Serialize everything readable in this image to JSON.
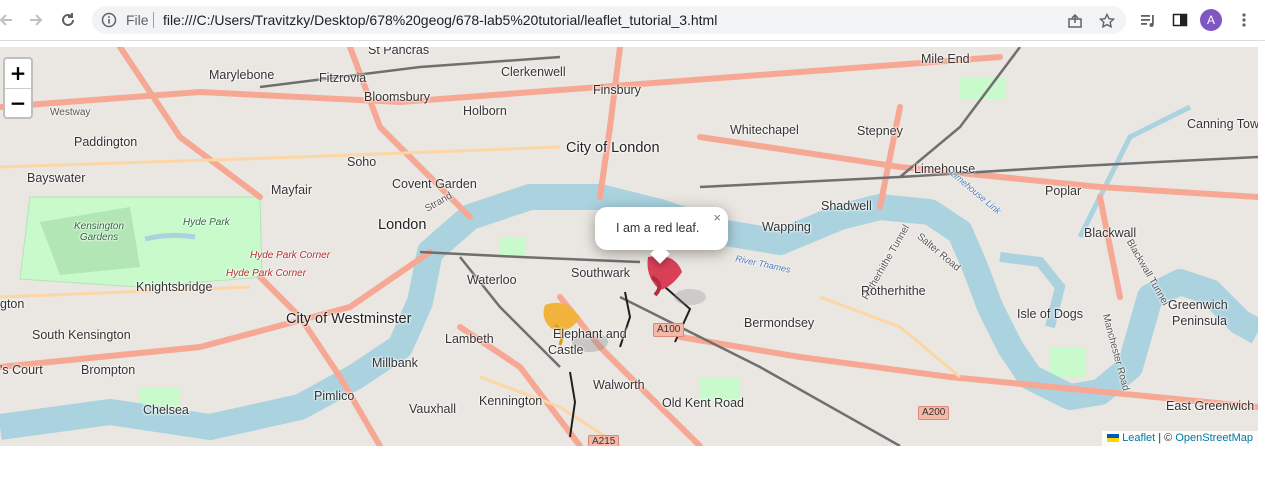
{
  "browser": {
    "scheme_label": "File",
    "url": "file:///C:/Users/Travitzky/Desktop/678%20geog/678-lab5%20tutorial/leaflet_tutorial_3.html",
    "avatar_initial": "A",
    "icons": [
      "back-arrow-icon",
      "forward-arrow-icon",
      "reload-icon",
      "info-icon",
      "share-icon",
      "star-icon",
      "media-icon",
      "side-panel-icon",
      "kebab-menu-icon"
    ],
    "avatar_color": "#7e57c2"
  },
  "map": {
    "zoom_in": "+",
    "zoom_out": "−",
    "popup": {
      "text": "I am a red leaf.",
      "close": "×"
    },
    "attribution": {
      "leaflet": "Leaflet",
      "sep": " | © ",
      "osm": "OpenStreetMap"
    },
    "labels": {
      "st_pancras": "St Pancras",
      "marylebone": "Marylebone",
      "fitzrovia": "Fitzrovia",
      "clerkenwell": "Clerkenwell",
      "mile_end": "Mile End",
      "westway": "Westway",
      "bloomsbury": "Bloomsbury",
      "finsbury": "Finsbury",
      "paddington": "Paddington",
      "holborn": "Holborn",
      "whitechapel": "Whitechapel",
      "stepney": "Stepney",
      "canning_town": "Canning Tow",
      "city_of_london": "City of London",
      "soho": "Soho",
      "bayswater": "Bayswater",
      "covent_garden": "Covent Garden",
      "limehouse": "Limehouse",
      "mayfair": "Mayfair",
      "poplar": "Poplar",
      "strand": "Strand",
      "hyde_park": "Hyde Park",
      "kensington_gardens": "Kensington Gardens",
      "shadwell": "Shadwell",
      "london": "London",
      "wapping": "Wapping",
      "blackwall": "Blackwall",
      "hyde_park_corner_1": "Hyde Park Corner",
      "hyde_park_corner_2": "Hyde Park Corner",
      "waterloo": "Waterloo",
      "southwark": "Southwark",
      "knightsbridge": "Knightsbridge",
      "rotherhithe": "Rotherhithe",
      "greenwich": "Greenwich",
      "greenwich_peninsula": "Peninsula",
      "gton": "gton",
      "city_of_westminster": "City of Westminster",
      "bermondsey": "Bermondsey",
      "isle_of_dogs": "Isle of Dogs",
      "south_kensington": "South Kensington",
      "lambeth": "Lambeth",
      "elephant_and_castle": "Elephant and",
      "castle": "Castle",
      "millbank": "Millbank",
      "s_court": "'s Court",
      "brompton": "Brompton",
      "walworth": "Walworth",
      "pimlico": "Pimlico",
      "chelsea": "Chelsea",
      "vauxhall": "Vauxhall",
      "kennington": "Kennington",
      "old_kent_road": "Old Kent Road",
      "east_greenwich": "East Greenwich",
      "river_thames": "River Thames",
      "limehouse_link": "Limehouse Link",
      "rotherhithe_tunnel": "Rotherhithe Tunnel",
      "salter_road": "Salter Road",
      "manchester_road": "Manchester Road",
      "blackwall_tunnel": "Blackwall Tunnel"
    },
    "roads": {
      "a100": "A100",
      "a200": "A200",
      "a215": "A215"
    },
    "colors": {
      "water": "#aad3df",
      "park": "#c8facc",
      "major_road": "#f6a894",
      "land": "#f2efe9"
    }
  }
}
